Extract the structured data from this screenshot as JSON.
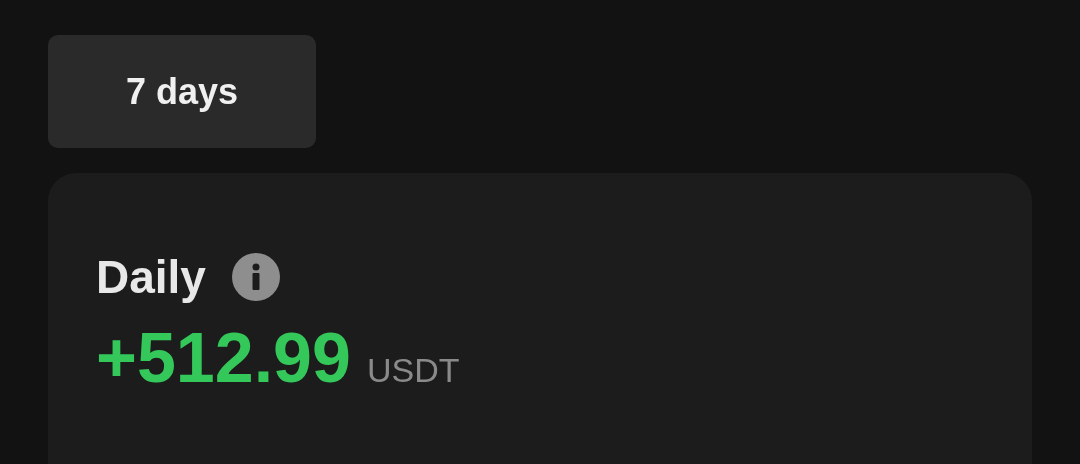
{
  "period_button": {
    "label": "7 days"
  },
  "card": {
    "title": "Daily",
    "value": "+512.99",
    "unit": "USDT"
  }
}
